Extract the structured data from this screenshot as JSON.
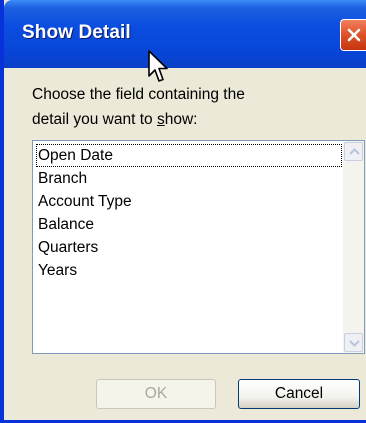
{
  "window": {
    "title": "Show Detail"
  },
  "prompt": {
    "line1": "Choose the field containing the",
    "line2_before": "detail you want to ",
    "line2_underlined": "s",
    "line2_after": "how:"
  },
  "fields": {
    "items": [
      "Open Date",
      "Branch",
      "Account Type",
      "Balance",
      "Quarters",
      "Years"
    ],
    "selected": "Open Date"
  },
  "buttons": {
    "ok": "OK",
    "cancel": "Cancel"
  },
  "colors": {
    "titlebar": "#0846d8",
    "close": "#e0552c",
    "dialog_bg": "#ece9d8"
  }
}
